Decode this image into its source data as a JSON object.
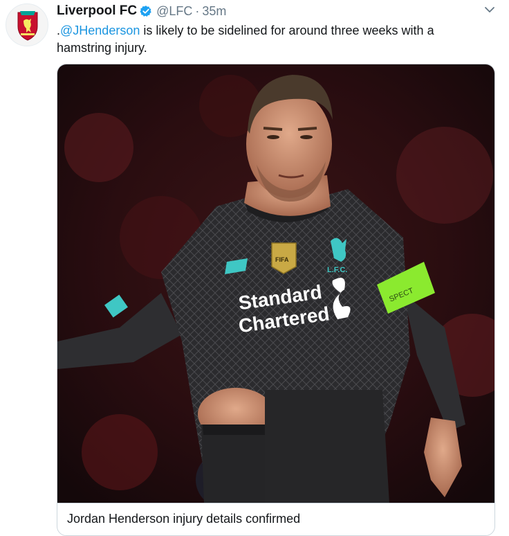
{
  "tweet": {
    "display_name": "Liverpool FC",
    "handle": "@LFC",
    "separator": "·",
    "time": "35m",
    "text_prefix": ".",
    "mention": "@JHenderson",
    "text_body": " is likely to be sidelined for around three weeks with a hamstring injury.",
    "verified": true
  },
  "card": {
    "title": "Jordan Henderson injury details confirmed",
    "image_texts": {
      "sponsor_line1": "Standard",
      "sponsor_line2": "Chartered",
      "crest_text": "L.F.C.",
      "badge_text": "FIFA",
      "armband_text": "SPECT"
    }
  },
  "colors": {
    "accent": "#1b95e0",
    "verified": "#1da1f2",
    "text": "#14171a",
    "muted": "#657786",
    "border": "#ccd6dd",
    "kit_dark": "#2b2b2e",
    "armband": "#8bea2f",
    "kit_trim": "#3fc7c4"
  },
  "icons": {
    "avatar": "liverbird-crest-icon",
    "verified": "verified-badge-icon",
    "menu": "chevron-down-icon"
  }
}
